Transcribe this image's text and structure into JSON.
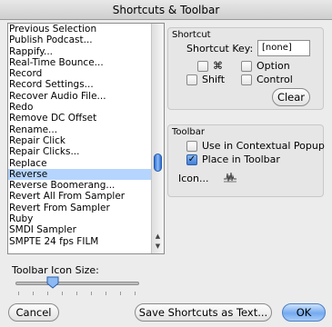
{
  "window": {
    "title": "Shortcuts & Toolbar"
  },
  "command_list": {
    "items": [
      "Previous Selection",
      "Publish Podcast...",
      "Rappify...",
      "Real-Time Bounce...",
      "Record",
      "Record Settings...",
      "Recover Audio File...",
      "Redo",
      "Remove DC Offset",
      "Rename...",
      "Repair Click",
      "Repair Clicks...",
      "Replace",
      "Reverse",
      "Reverse Boomerang...",
      "Revert All From Sampler",
      "Revert From Sampler",
      "Ruby",
      "SMDI Sampler",
      "SMPTE 24 fps FILM"
    ],
    "selected": "Reverse"
  },
  "shortcut": {
    "group_title": "Shortcut",
    "key_label": "Shortcut Key:",
    "key_value": "[none]",
    "cmd_symbol": "⌘",
    "option_label": "Option",
    "shift_label": "Shift",
    "control_label": "Control",
    "clear_label": "Clear"
  },
  "toolbar": {
    "group_title": "Toolbar",
    "contextual_label": "Use in Contextual Popup",
    "place_label": "Place in Toolbar",
    "place_checked": true,
    "icon_label": "Icon..."
  },
  "icon_size": {
    "label": "Toolbar Icon Size:"
  },
  "buttons": {
    "cancel": "Cancel",
    "save_text": "Save Shortcuts as Text...",
    "ok": "OK"
  }
}
